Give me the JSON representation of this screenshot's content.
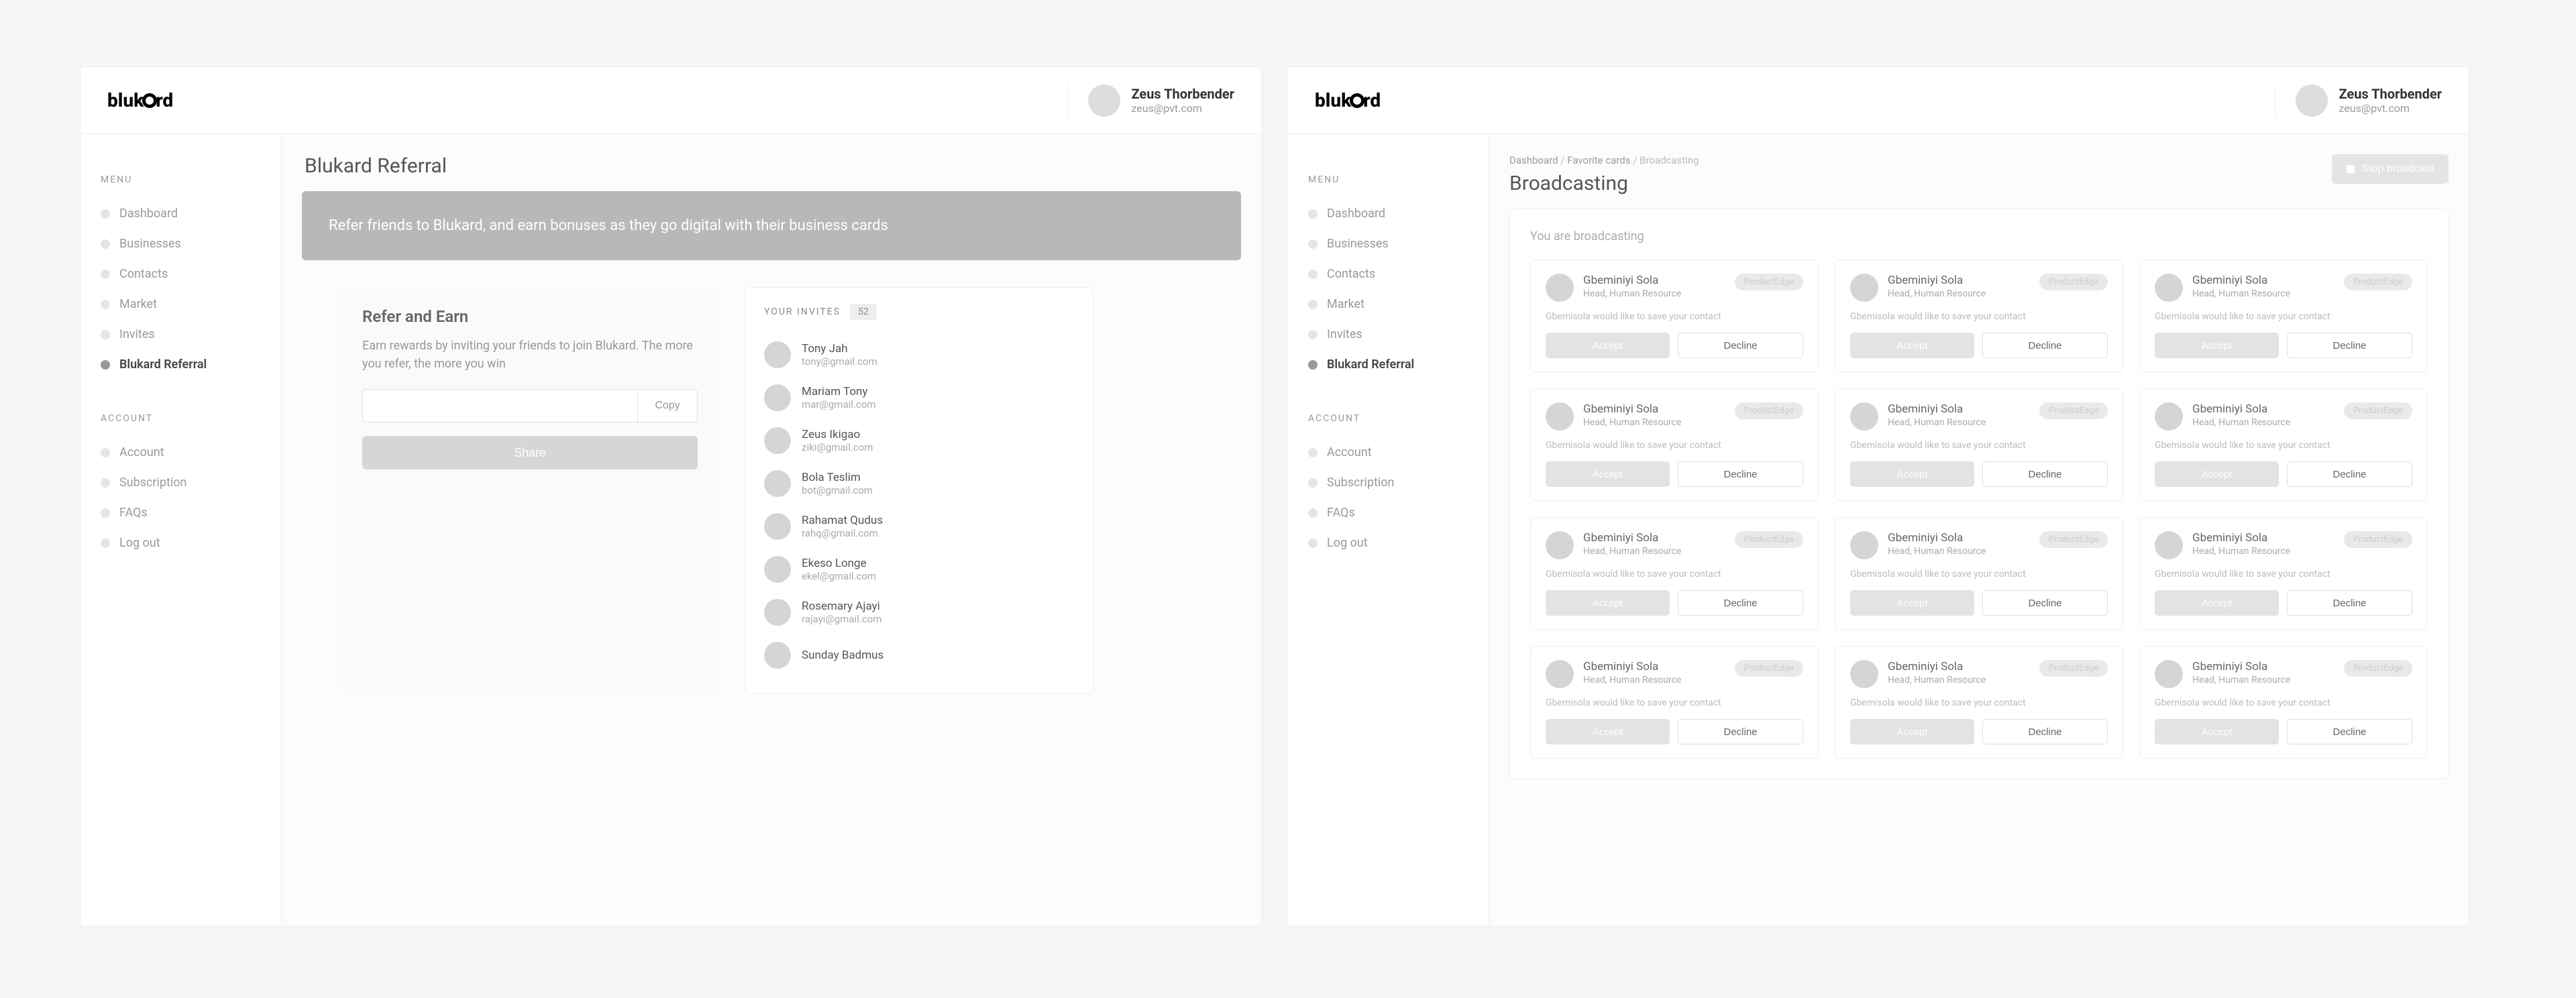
{
  "brand": "blukard",
  "user": {
    "name": "Zeus Thorbender",
    "email": "zeus@pvt.com"
  },
  "sidebar": {
    "menu_title": "MENU",
    "account_title": "ACCOUNT",
    "menu_items": [
      {
        "label": "Dashboard"
      },
      {
        "label": "Businesses"
      },
      {
        "label": "Contacts"
      },
      {
        "label": "Market"
      },
      {
        "label": "Invites"
      },
      {
        "label": "Blukard Referral"
      }
    ],
    "account_items": [
      {
        "label": "Account"
      },
      {
        "label": "Subscription"
      },
      {
        "label": "FAQs"
      },
      {
        "label": "Log out"
      }
    ]
  },
  "left_page": {
    "title": "Blukard Referral",
    "banner": "Refer friends to Blukard, and earn bonuses as they go digital with their business cards",
    "refer_title": "Refer and Earn",
    "refer_desc": "Earn rewards by inviting your friends to join Blukard. The more you refer, the more you win",
    "copy_label": "Copy",
    "share_label": "Share",
    "invites_title": "YOUR INVITES",
    "invites_count": "52",
    "invites": [
      {
        "name": "Tony Jah",
        "email": "tony@gmail.com"
      },
      {
        "name": "Mariam Tony",
        "email": "mar@gmail.com"
      },
      {
        "name": "Zeus Ikigao",
        "email": "ziki@gmail.com"
      },
      {
        "name": "Bola Teslim",
        "email": "bot@gmail.com"
      },
      {
        "name": "Rahamat Qudus",
        "email": "rahq@gmail.com"
      },
      {
        "name": "Ekeso Longe",
        "email": "ekel@gmail.com"
      },
      {
        "name": "Rosemary Ajayi",
        "email": "rajayi@gmail.com"
      },
      {
        "name": "Sunday Badmus",
        "email": ""
      }
    ]
  },
  "right_page": {
    "crumb1": "Dashboard",
    "crumb2": "Favorite cards",
    "crumb3": "Broadcasting",
    "title": "Broadcasting",
    "stop_label": "Stop broadcast",
    "panel_sub": "You are broadcasting",
    "card": {
      "name": "Gbeminiyi Sola",
      "role": "Head, Human Resource",
      "badge": "ProductEdge",
      "message": "Gbemisola would like to save your contact",
      "accept": "Accept",
      "decline": "Decline"
    },
    "card_count": 12
  }
}
